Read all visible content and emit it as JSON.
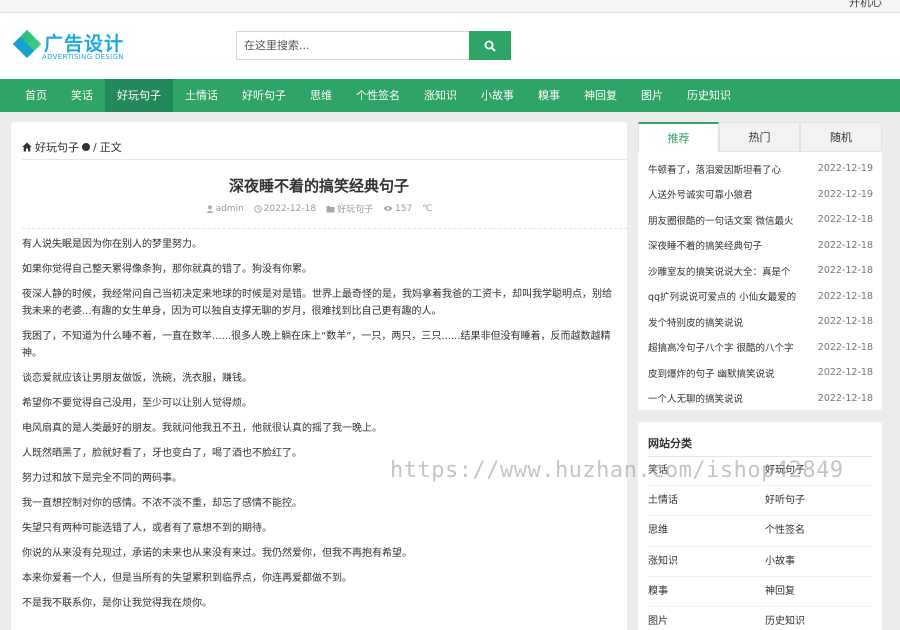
{
  "topbar": {
    "text": "开机心"
  },
  "logo": {
    "cn": "广告设计",
    "en": "ADVERTISING DESIGN"
  },
  "search": {
    "placeholder": "在这里搜索..."
  },
  "nav": [
    {
      "label": "首页"
    },
    {
      "label": "笑话"
    },
    {
      "label": "好玩句子",
      "active": true
    },
    {
      "label": "土情话"
    },
    {
      "label": "好听句子"
    },
    {
      "label": "思维"
    },
    {
      "label": "个性签名"
    },
    {
      "label": "涨知识"
    },
    {
      "label": "小故事"
    },
    {
      "label": "糗事"
    },
    {
      "label": "神回复"
    },
    {
      "label": "图片"
    },
    {
      "label": "历史知识"
    }
  ],
  "breadcrumb": {
    "category": "好玩句子",
    "current": "正文"
  },
  "article": {
    "title": "深夜睡不着的搞笑经典句子",
    "author": "admin",
    "date": "2022-12-18",
    "category": "好玩句子",
    "views": "157",
    "unit": "℃",
    "paragraphs": [
      "有人说失眠是因为你在别人的梦里努力。",
      "如果你觉得自己整天累得像条狗，那你就真的错了。狗没有你累。",
      "夜深人静的时候，我经常问自己当初决定来地球的时候是对是错。世界上最奇怪的是，我妈拿着我爸的工资卡，却叫我学聪明点，别给我未来的老婆...有趣的女生单身，因为可以独自支撑无聊的岁月，很难找到比自己更有趣的人。",
      "我困了，不知道为什么睡不着，一直在数羊......很多人晚上躺在床上“数羊”，一只，两只，三只......结果非但没有睡着，反而越数越精神。",
      "谈恋爱就应该让男朋友做饭，洗碗，洗衣服，赚钱。",
      "希望你不要觉得自己没用，至少可以让别人觉得烦。",
      "电风扇真的是人类最好的朋友。我就问他我丑不丑，他就很认真的摇了我一晚上。",
      "人既然晒黑了，脸就好看了，牙也变白了，喝了酒也不脸红了。",
      "努力过和放下是完全不同的两码事。",
      "我一直想控制对你的感情。不浓不淡不重，却忘了感情不能控。",
      "失望只有两种可能选错了人，或者有了意想不到的期待。",
      "你说的从来没有兑现过，承诺的未来也从来没有来过。我仍然爱你，但我不再抱有希望。",
      "本来你爱着一个人，但是当所有的失望累积到临界点，你连再爱都做不到。",
      "不是我不联系你，是你让我觉得我在烦你。"
    ]
  },
  "tabs": {
    "labels": [
      "推荐",
      "热门",
      "随机"
    ],
    "items": [
      {
        "title": "牛顿看了，落泪爱因斯坦看了心",
        "date": "2022-12-19"
      },
      {
        "title": "人送外号诚实可靠小狼君",
        "date": "2022-12-19"
      },
      {
        "title": "朋友圈很酷的一句话文案 微信最火",
        "date": "2022-12-18"
      },
      {
        "title": "深夜睡不着的搞笑经典句子",
        "date": "2022-12-18"
      },
      {
        "title": "沙雕室友的搞笑说说大全：真是个",
        "date": "2022-12-18"
      },
      {
        "title": "qq扩列说说可爱点的 小仙女最爱的",
        "date": "2022-12-18"
      },
      {
        "title": "发个特别皮的搞笑说说",
        "date": "2022-12-18"
      },
      {
        "title": "超搞高冷句子八个字 很酷的八个字",
        "date": "2022-12-18"
      },
      {
        "title": "皮到爆炸的句子 幽默搞笑说说",
        "date": "2022-12-18"
      },
      {
        "title": "一个人无聊的搞笑说说",
        "date": "2022-12-18"
      }
    ]
  },
  "categories": {
    "title": "网站分类",
    "items": [
      "笑话",
      "好玩句子",
      "土情话",
      "好听句子",
      "思维",
      "个性签名",
      "涨知识",
      "小故事",
      "糗事",
      "神回复",
      "图片",
      "历史知识"
    ]
  },
  "watermark": "https://www.huzhan.com/ishop42849",
  "colors": {
    "accent": "#2ea466",
    "nav_active": "#23885a",
    "logo": "#1ea8e0"
  }
}
